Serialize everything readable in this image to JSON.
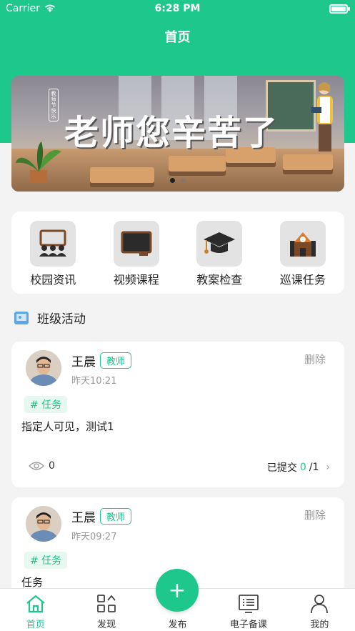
{
  "status_bar": {
    "carrier": "Carrier",
    "time": "6:28 PM"
  },
  "nav": {
    "title": "首页"
  },
  "banner": {
    "headline": "老师您辛苦了",
    "small_text": "教师节快乐",
    "slides": 2,
    "active_slide": 0
  },
  "menu": {
    "items": [
      {
        "label": "校园资讯",
        "icon": "classroom-icon"
      },
      {
        "label": "视频课程",
        "icon": "blackboard-icon"
      },
      {
        "label": "教案检查",
        "icon": "graduation-cap-icon"
      },
      {
        "label": "巡课任务",
        "icon": "school-building-icon"
      }
    ]
  },
  "section": {
    "title": "班级活动"
  },
  "posts": [
    {
      "author": "王晨",
      "role": "教师",
      "time": "昨天10:21",
      "delete": "删除",
      "tag": "# 任务",
      "content": "指定人可见，测试1",
      "views": "0",
      "submitted_label": "已提交",
      "submitted": "0",
      "total": "/1"
    },
    {
      "author": "王晨",
      "role": "教师",
      "time": "昨天09:27",
      "delete": "删除",
      "tag": "# 任务",
      "content": "任务"
    }
  ],
  "tabbar": {
    "items": [
      {
        "label": "首页",
        "icon": "home-icon",
        "active": true
      },
      {
        "label": "发现",
        "icon": "discover-icon"
      },
      {
        "label": "发布",
        "icon": "plus-icon"
      },
      {
        "label": "电子备课",
        "icon": "lesson-plan-icon"
      },
      {
        "label": "我的",
        "icon": "profile-icon"
      }
    ],
    "publish_symbol": "+"
  },
  "colors": {
    "accent": "#1ec78b",
    "background": "#f3f3f3"
  }
}
